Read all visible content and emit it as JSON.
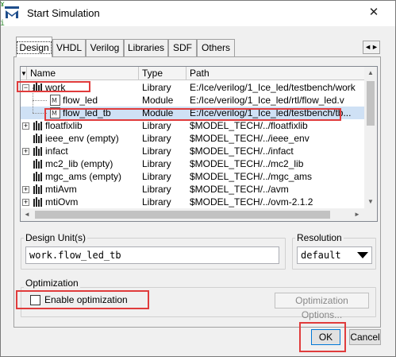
{
  "window": {
    "title": "Start Simulation",
    "close_glyph": "✕",
    "left_strip_text": "ɤ\n\ni"
  },
  "tabs": [
    {
      "label": "Design"
    },
    {
      "label": "VHDL"
    },
    {
      "label": "Verilog"
    },
    {
      "label": "Libraries"
    },
    {
      "label": "SDF"
    },
    {
      "label": "Others"
    }
  ],
  "tab_scroll_glyph": "◄►",
  "list": {
    "sort_glyph": "▼",
    "columns": {
      "name": "Name",
      "type": "Type",
      "path": "Path"
    },
    "rows": [
      {
        "name": "work",
        "type": "Library",
        "path": "E:/Ice/verilog/1_Ice_led/testbench/work",
        "kind": "library",
        "expander": "−",
        "indent": 0
      },
      {
        "name": "flow_led",
        "type": "Module",
        "path": "E:/Ice/verilog/1_Ice_led/rtl/flow_led.v",
        "kind": "module",
        "expander": "",
        "indent": 1
      },
      {
        "name": "flow_led_tb",
        "type": "Module",
        "path": "E:/Ice/verilog/1_Ice_led/testbench/tb...",
        "kind": "module",
        "expander": "",
        "indent": 1,
        "selected": true
      },
      {
        "name": "floatfixlib",
        "type": "Library",
        "path": "$MODEL_TECH/../floatfixlib",
        "kind": "library",
        "expander": "+",
        "indent": 0
      },
      {
        "name": "ieee_env  (empty)",
        "type": "Library",
        "path": "$MODEL_TECH/../ieee_env",
        "kind": "library",
        "expander": "",
        "indent": 0
      },
      {
        "name": "infact",
        "type": "Library",
        "path": "$MODEL_TECH/../infact",
        "kind": "library",
        "expander": "+",
        "indent": 0
      },
      {
        "name": "mc2_lib  (empty)",
        "type": "Library",
        "path": "$MODEL_TECH/../mc2_lib",
        "kind": "library",
        "expander": "",
        "indent": 0
      },
      {
        "name": "mgc_ams  (empty)",
        "type": "Library",
        "path": "$MODEL_TECH/../mgc_ams",
        "kind": "library",
        "expander": "",
        "indent": 0
      },
      {
        "name": "mtiAvm",
        "type": "Library",
        "path": "$MODEL_TECH/../avm",
        "kind": "library",
        "expander": "+",
        "indent": 0
      },
      {
        "name": "mtiOvm",
        "type": "Library",
        "path": "$MODEL_TECH/../ovm-2.1.2",
        "kind": "library",
        "expander": "+",
        "indent": 0
      }
    ]
  },
  "scrollbar": {
    "up": "▲",
    "down": "▼",
    "left": "◄",
    "right": "►"
  },
  "design_unit": {
    "label": "Design Unit(s)",
    "value": "work.flow_led_tb"
  },
  "resolution": {
    "label": "Resolution",
    "value": "default"
  },
  "optimization": {
    "label": "Optimization",
    "checkbox_label": "Enable optimization",
    "checked": false,
    "options_button": "Optimization Options..."
  },
  "buttons": {
    "ok": "OK",
    "cancel": "Cancel"
  },
  "colors": {
    "annotation": "#e03c3c",
    "selection": "#cfe1f5",
    "titlebar_icon": "#1f4e8c"
  }
}
